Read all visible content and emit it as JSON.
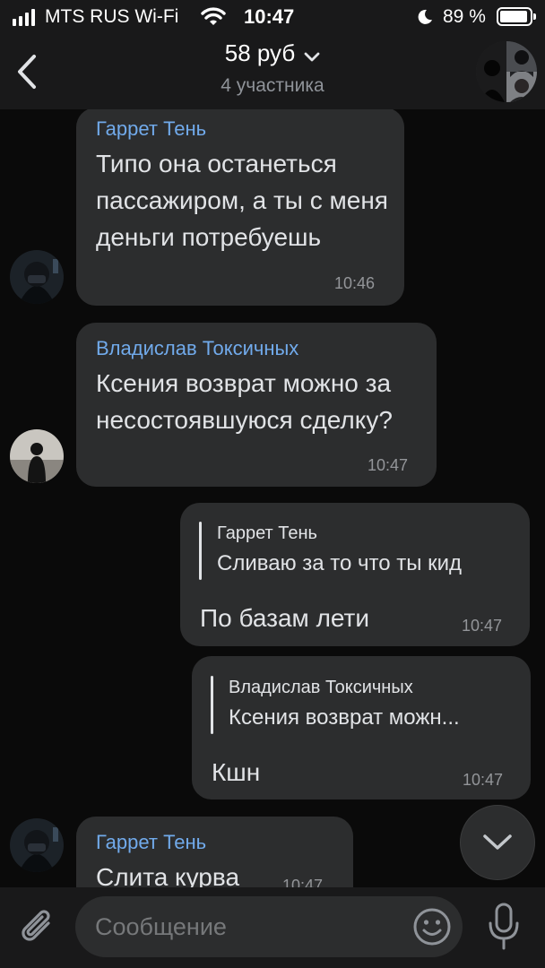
{
  "status_bar": {
    "carrier": "MTS RUS Wi-Fi",
    "time": "10:47",
    "battery": "89 %",
    "battery_level": 0.89
  },
  "header": {
    "title": "58 руб",
    "subtitle": "4 участника"
  },
  "messages": [
    {
      "author": "Гаррет Тень",
      "text": "Типо она останеться пассажиром, а ты с меня деньги потребуешь",
      "time": "10:46",
      "incoming": true
    },
    {
      "author": "Владислав Токсичных",
      "text": "Ксения возврат можно за несостоявшуюся сделку?",
      "time": "10:47",
      "incoming": true
    },
    {
      "reply_author": "Гаррет Тень",
      "reply_text": "Сливаю за то что ты кид",
      "text": "По базам лети",
      "time": "10:47",
      "incoming": false
    },
    {
      "reply_author": "Владислав Токсичных",
      "reply_text": "Ксения возврат можн...",
      "text": "Кшн",
      "time": "10:47",
      "incoming": false
    },
    {
      "author": "Гаррет Тень",
      "text": "Слита курва",
      "time": "10:47",
      "incoming": true
    }
  ],
  "composer": {
    "placeholder": "Сообщение"
  },
  "colors": {
    "background": "#0a0a0a",
    "bubble": "#2c2d2e",
    "author": "#71aaeb",
    "text": "#e1e3e6"
  }
}
